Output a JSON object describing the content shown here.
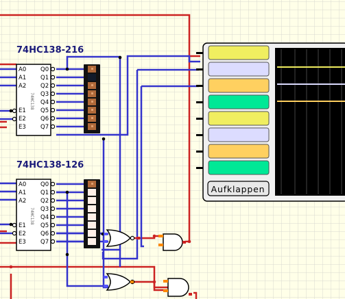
{
  "components": {
    "decoder_top": {
      "title": "74HC138-216",
      "chip_label": "74HC138",
      "inputs": [
        "A0",
        "A1",
        "A2",
        "E1",
        "E2",
        "E3"
      ],
      "outputs": [
        "Q0",
        "Q1",
        "Q2",
        "Q3",
        "Q4",
        "Q5",
        "Q6",
        "Q7"
      ],
      "led_states": [
        "brown",
        "dark",
        "brown",
        "brown",
        "brown",
        "brown",
        "brown",
        "brown"
      ]
    },
    "decoder_bottom": {
      "title": "74HC138-126",
      "chip_label": "74HC138",
      "inputs": [
        "A0",
        "A1",
        "A2",
        "E1",
        "E2",
        "E3"
      ],
      "outputs": [
        "Q0",
        "Q1",
        "Q2",
        "Q3",
        "Q4",
        "Q5",
        "Q6",
        "Q7"
      ],
      "led_states": [
        "brown",
        "off",
        "off",
        "off",
        "off",
        "off",
        "off",
        "off"
      ]
    }
  },
  "logic_analyzer": {
    "channel_colors": [
      "#f0ee60",
      "#dcdcff",
      "#ffd060",
      "#00e896",
      "#f0ee60",
      "#dcdcff",
      "#ffd060",
      "#00e896"
    ],
    "button_label": "Aufklappen",
    "trace_colors": [
      "#f0ee60",
      "#dcdcff",
      "#ffd060"
    ]
  },
  "colors": {
    "background": "#ffffe8",
    "grid": "#d8d8d0",
    "wire_red": "#cc2222",
    "wire_blue": "#3333cc",
    "led_brown": "#b06a3a",
    "led_off": "#fff0e8"
  }
}
